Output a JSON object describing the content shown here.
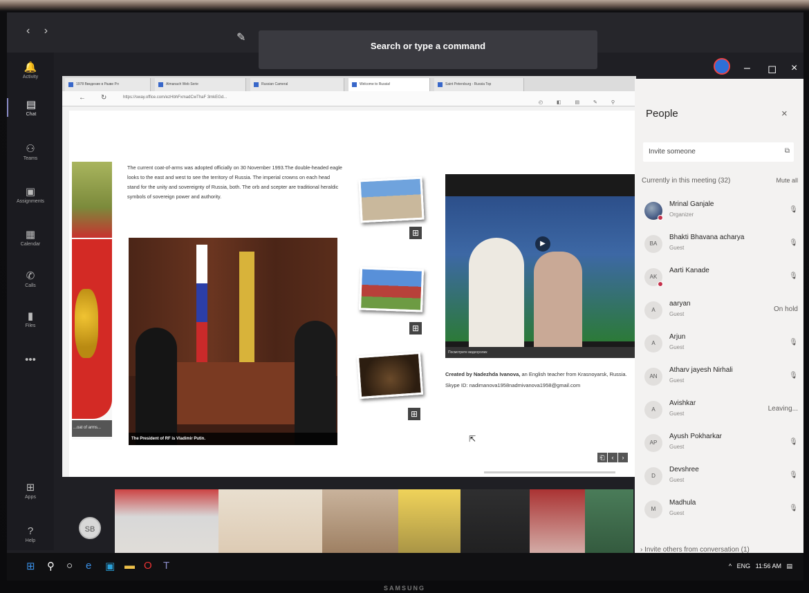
{
  "topbar": {
    "back": "‹",
    "forward": "›",
    "search_placeholder": "Search or type a command",
    "minimize": "–",
    "restore": "◻",
    "close": "×"
  },
  "rail": [
    {
      "label": "Activity",
      "icon": "bell-icon",
      "glyph": "🔔"
    },
    {
      "label": "Chat",
      "icon": "chat-icon",
      "glyph": "▤"
    },
    {
      "label": "Teams",
      "icon": "teams-icon",
      "glyph": "⚇"
    },
    {
      "label": "Assignments",
      "icon": "assignments-icon",
      "glyph": "▣"
    },
    {
      "label": "Calendar",
      "icon": "calendar-icon",
      "glyph": "▦"
    },
    {
      "label": "Calls",
      "icon": "phone-icon",
      "glyph": "✆"
    },
    {
      "label": "Files",
      "icon": "files-icon",
      "glyph": "▮"
    },
    {
      "label": "...",
      "icon": "more-icon",
      "glyph": "•••"
    },
    {
      "label": "Apps",
      "icon": "apps-icon",
      "glyph": "⊞"
    },
    {
      "label": "Help",
      "icon": "help-icon",
      "glyph": "?"
    }
  ],
  "user_initials": "SB",
  "browser": {
    "tabs": [
      "1978 Введение в Разве Рл",
      "Almanach Web Serie",
      "Russian Cameral",
      "Welcome to Russia!",
      "Saint Petersburg - Russia Top"
    ],
    "url": "https://sway.office.com/ezHbhFxmadCwThaF 3mkEGd..."
  },
  "page": {
    "flag_caption": "...oat of arms...",
    "paragraph": "The current coat-of-arms was adopted officially on 30 November 1993.The double-headed eagle looks to the east and west to see the territory of Russia. The imperial crowns on each head stand for the unity and sovereignty of Russia, both. The orb and scepter are traditional heraldic symbols of sovereign power and authority.",
    "photo_caption": "The President of RF is Vladimir Putin.",
    "video_caption": "Посмотрите видеоролик",
    "grid_icon": "⊞",
    "credits_bold": "Created by Nadezhda Ivanova,",
    "credits_rest": " an English teacher from Krasnoyarsk, Russia.",
    "credits_skype": "Skype ID: nadimanova1958nadmivanova1958@gmail.com",
    "pager": [
      "⎗",
      "‹",
      "›"
    ]
  },
  "people": {
    "title": "People",
    "invite_placeholder": "Invite someone",
    "section": "Currently in this meeting (32)",
    "mute_all": "Mute all",
    "members": [
      {
        "initials": "",
        "name": "Mrinal Ganjale",
        "role": "Organizer",
        "status": "🎙",
        "photo": true,
        "alert": true
      },
      {
        "initials": "BA",
        "name": "Bhakti Bhavana acharya",
        "role": "Guest",
        "status": "🎙"
      },
      {
        "initials": "AK",
        "name": "Aarti Kanade",
        "role": "",
        "status": "🎙",
        "alert": true
      },
      {
        "initials": "A",
        "name": "aaryan",
        "role": "Guest",
        "status": "On hold"
      },
      {
        "initials": "A",
        "name": "Arjun",
        "role": "Guest",
        "status": "🎙"
      },
      {
        "initials": "AN",
        "name": "Atharv jayesh Nirhali",
        "role": "Guest",
        "status": "🎙"
      },
      {
        "initials": "A",
        "name": "Avishkar",
        "role": "Guest",
        "status": "Leaving..."
      },
      {
        "initials": "AP",
        "name": "Ayush Pokharkar",
        "role": "Guest",
        "status": "🎙"
      },
      {
        "initials": "D",
        "name": "Devshree",
        "role": "Guest",
        "status": "🎙"
      },
      {
        "initials": "M",
        "name": "Madhula",
        "role": "Guest",
        "status": "🎙"
      }
    ],
    "invite_others": "› Invite others from conversation (1)"
  },
  "taskbar": {
    "tray": "ENG",
    "time": "11:56 AM"
  },
  "monitor_brand": "SAMSUNG"
}
